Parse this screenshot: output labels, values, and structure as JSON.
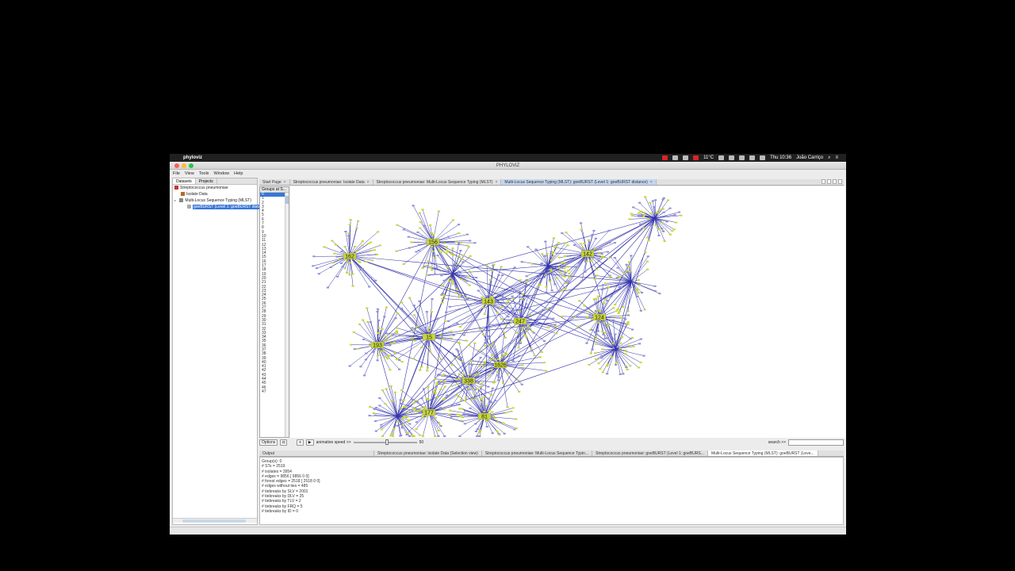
{
  "menubar": {
    "app": "phyloviz",
    "temp": "11°C",
    "clock": "Thu 10:36",
    "user": "João Carriço"
  },
  "window": {
    "title": "PHYLOViZ"
  },
  "app_menu": [
    "File",
    "View",
    "Tools",
    "Window",
    "Help"
  ],
  "left_panel": {
    "tabs": [
      "Datasets",
      "Projects"
    ],
    "tree": [
      {
        "label": "Streptococcus pneumoniae",
        "indent": 0,
        "icon": "dataset-icon"
      },
      {
        "label": "Isolate Data",
        "indent": 1,
        "icon": "table-icon"
      },
      {
        "label": "Multi-Locus Sequence Typing (MLST)",
        "indent": 1,
        "icon": "mlst-icon"
      },
      {
        "label": "goeBURST (Level 1: goeBURST distance)",
        "indent": 2,
        "icon": "tree-icon"
      }
    ]
  },
  "editor_tabs": [
    {
      "label": "Start Page",
      "active": false
    },
    {
      "label": "Streptococcus pneumoniae: Isolate Data",
      "active": false
    },
    {
      "label": "Streptococcus pneumoniae: Multi-Locus Sequence Typing (MLST)",
      "active": false
    },
    {
      "label": "Multi-Locus Sequence Typing (MLST): goeBURST (Level 1: goeBURST distance)",
      "active": true
    }
  ],
  "groups": {
    "header": "Groups at S...",
    "items": [
      "0",
      "1",
      "2",
      "3",
      "4",
      "5",
      "6",
      "7",
      "8",
      "9",
      "10",
      "11",
      "12",
      "13",
      "14",
      "15",
      "16",
      "17",
      "18",
      "19",
      "20",
      "21",
      "22",
      "23",
      "24",
      "25",
      "26",
      "27",
      "28",
      "29",
      "30",
      "31",
      "32",
      "33",
      "34",
      "35",
      "36",
      "37",
      "38",
      "39",
      "40",
      "41",
      "42",
      "43",
      "44",
      "45",
      "46",
      "47"
    ]
  },
  "graph": {
    "node_color": "#c8d63a",
    "edge_color": "#3333aa",
    "hub_labels": [
      "162",
      "156",
      "193",
      "15",
      "143",
      "247",
      "1626",
      "338",
      "142",
      "124",
      "177",
      "81"
    ]
  },
  "controls": {
    "options": "Options",
    "animation_label": "animation speed >>",
    "speed": "50",
    "search_label": "search >>"
  },
  "output_tabs": [
    {
      "label": "Output",
      "active": false
    },
    {
      "label": "Streptococcus pneumoniae: Isolate Data (Selection view)",
      "active": false
    },
    {
      "label": "Streptococcus pneumoniae: Multi-Locus Sequence Typin...",
      "active": false
    },
    {
      "label": "Streptococcus pneumoniae: goeBURST (Level 1: goeBURS...",
      "active": false
    },
    {
      "label": "Multi-Locus Sequence Typing (MLST): goeBURST (Leve...",
      "active": true
    }
  ],
  "output_lines": [
    "Group(s): 0",
    "# STs = 2519",
    "# isolates = 3954",
    "# edges = 9856 [ 9856 0 0]",
    "# forest edges = 2518 [ 2518 0 0]",
    "# edges without ties = 485",
    "# tiebreaks by SLV = 2001",
    "# tiebreaks by DLV = 25",
    "# tiebreaks by TLV = 2",
    "# tiebreaks by FRQ = 5",
    "# tiebreaks by ID = 0"
  ]
}
